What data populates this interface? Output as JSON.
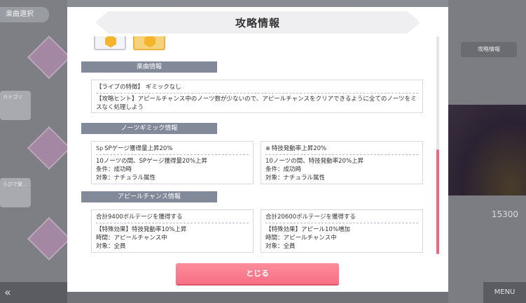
{
  "background": {
    "screen_title": "楽曲選択",
    "right_button": "攻略情報",
    "score": "15300",
    "menu_label": "MENU",
    "back_icon": "double-chevron-left",
    "left_chip_1": "らびで繋…",
    "left_chip_2": "カテゴリ"
  },
  "modal": {
    "title": "攻略情報",
    "close_label": "とじる"
  },
  "sections": {
    "song_info": {
      "header": "楽曲情報",
      "live_feature": "【ライブの特徴】 ギミックなし",
      "hint": "【攻略ヒント】アピールチャンス中のノーツ数が少ないので、アピールチャンスをクリアできるように全てのノーツをミスなく処理しよう"
    },
    "notes_gimmick": {
      "header": "ノーツギミック情報",
      "cards": [
        {
          "icon": "sp-gauge-icon",
          "icon_text": "Sp",
          "title": "SPゲージ獲得量上昇20%",
          "desc": "10ノーツの間、SPゲージ獲得量20%上昇",
          "condition": "条件：成功時",
          "target": "対象：ナチュラル属性"
        },
        {
          "icon": "skill-rate-icon",
          "icon_text": "⊕",
          "title": "特技発動率上昇20%",
          "desc": "10ノーツの間、特技発動率20%上昇",
          "condition": "条件：成功時",
          "target": "対象：ナチュラル属性"
        }
      ]
    },
    "appeal_chance": {
      "header": "アピールチャンス情報",
      "cards": [
        {
          "title": "合計9400ボルテージを獲得する",
          "effect": "【特殊効果】特技発動率10%上昇",
          "time": "時間：アピールチャンス中",
          "target": "対象：全員"
        },
        {
          "title": "合計20600ボルテージを獲得する",
          "effect": "【特殊効果】アピール10%増加",
          "time": "時間：アピールチャンス中",
          "target": "対象：全員"
        }
      ]
    }
  },
  "colors": {
    "accent": "#f66f83",
    "section_header": "#828a9a",
    "scroll_thumb": "#f0687d"
  }
}
